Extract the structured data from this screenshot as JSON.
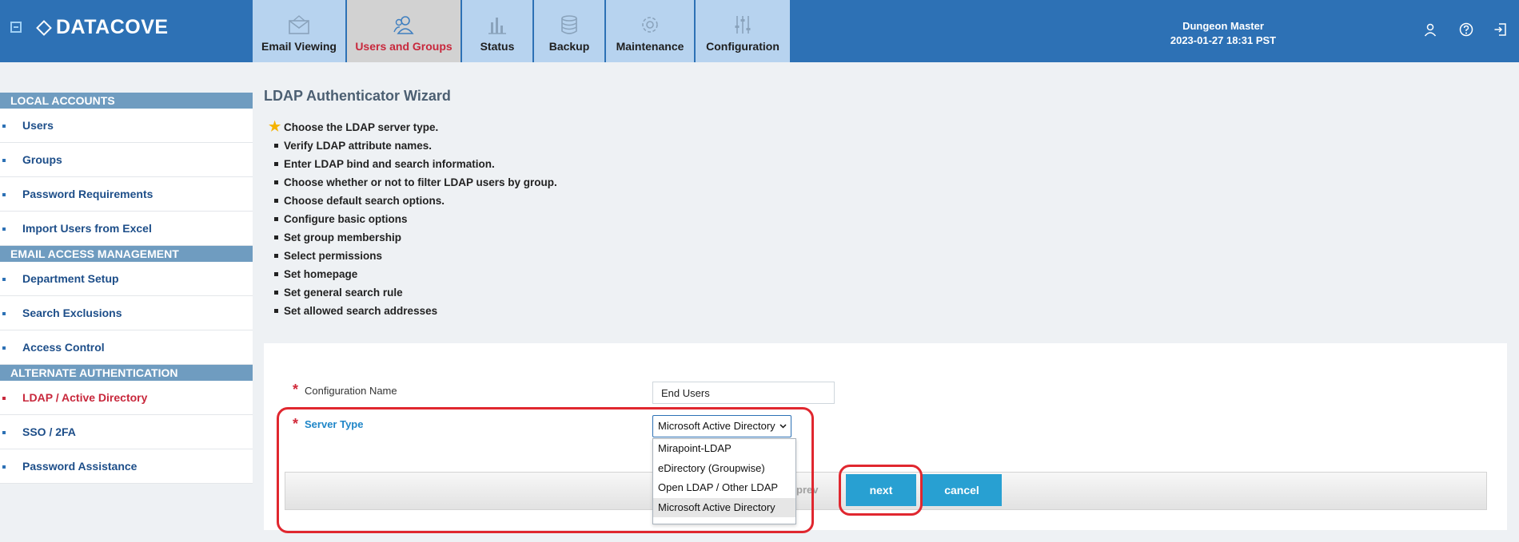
{
  "app": {
    "name": "DATACOVE"
  },
  "tabs": [
    {
      "label": "Email Viewing",
      "icon": "envelope-icon",
      "active": false
    },
    {
      "label": "Users and Groups",
      "icon": "users-icon",
      "active": true
    },
    {
      "label": "Status",
      "icon": "bar-chart-icon",
      "active": false
    },
    {
      "label": "Backup",
      "icon": "database-icon",
      "active": false
    },
    {
      "label": "Maintenance",
      "icon": "gear-icon",
      "active": false
    },
    {
      "label": "Configuration",
      "icon": "sliders-icon",
      "active": false
    }
  ],
  "user": {
    "name": "Dungeon Master",
    "datetime": "2023-01-27 18:31 PST"
  },
  "sidebar": {
    "sections": [
      {
        "title": "LOCAL ACCOUNTS",
        "items": [
          "Users",
          "Groups",
          "Password Requirements",
          "Import Users from Excel"
        ]
      },
      {
        "title": "EMAIL ACCESS MANAGEMENT",
        "items": [
          "Department Setup",
          "Search Exclusions",
          "Access Control"
        ]
      },
      {
        "title": "ALTERNATE AUTHENTICATION",
        "items": [
          "LDAP / Active Directory",
          "SSO / 2FA",
          "Password Assistance"
        ]
      }
    ],
    "active_item": "LDAP / Active Directory"
  },
  "wizard": {
    "title": "LDAP Authenticator Wizard",
    "steps": [
      "Choose the LDAP server type.",
      "Verify LDAP attribute names.",
      "Enter LDAP bind and search information.",
      "Choose whether or not to filter LDAP users by group.",
      "Choose default search options.",
      "Configure basic options",
      "Set group membership",
      "Select permissions",
      "Set homepage",
      "Set general search rule",
      "Set allowed search addresses"
    ]
  },
  "form": {
    "required_mark": "*",
    "config_name_label": "Configuration Name",
    "config_name_value": "End Users",
    "server_type_label": "Server Type",
    "server_type_value": "Microsoft Active Directory",
    "server_type_options": [
      "Mirapoint-LDAP",
      "eDirectory (Groupwise)",
      "Open LDAP / Other LDAP",
      "Microsoft Active Directory"
    ],
    "prev_label_partial": "prev",
    "next_label": "next",
    "cancel_label": "cancel"
  },
  "colors": {
    "header": "#2d71b5",
    "accent_red": "#c8283c",
    "button": "#28a0d2",
    "highlight": "#e0272f"
  }
}
